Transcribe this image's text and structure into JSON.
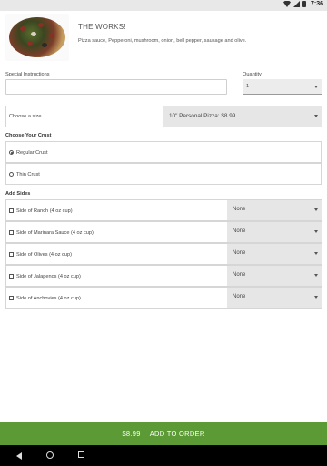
{
  "status_bar": {
    "time": "7:36"
  },
  "item": {
    "title": "THE WORKS!",
    "description": "Pizza sauce, Pepperoni, mushroom, onion, bell pepper, sausage and olive."
  },
  "special_instructions": {
    "label": "Special Instructions",
    "value": ""
  },
  "quantity": {
    "label": "Quantity",
    "value": "1"
  },
  "size": {
    "label": "Choose a size",
    "selected": "10\" Personal Pizza: $8.99"
  },
  "crust": {
    "label": "Choose Your Crust",
    "options": [
      {
        "label": "Regular Crust",
        "selected": true
      },
      {
        "label": "Thin Crust",
        "selected": false
      }
    ]
  },
  "sides": {
    "label": "Add Sides",
    "items": [
      {
        "label": "Side of Ranch (4 oz cup)",
        "value": "None"
      },
      {
        "label": "Side of Marinara Sauce (4 oz cup)",
        "value": "None"
      },
      {
        "label": "Side of Olives (4 oz cup)",
        "value": "None"
      },
      {
        "label": "Side of Jalapenos (4 oz cup)",
        "value": "None"
      },
      {
        "label": "Side of Anchovies (4 oz cup)",
        "value": "None"
      }
    ]
  },
  "order": {
    "price": "$8.99",
    "button_label": "ADD TO ORDER"
  },
  "colors": {
    "accent": "#5b9a35",
    "statusbar": "#e8e8e8",
    "select_bg": "#e6e6e6"
  },
  "nav": {
    "icons": [
      "back-icon",
      "home-icon",
      "recents-icon"
    ]
  }
}
